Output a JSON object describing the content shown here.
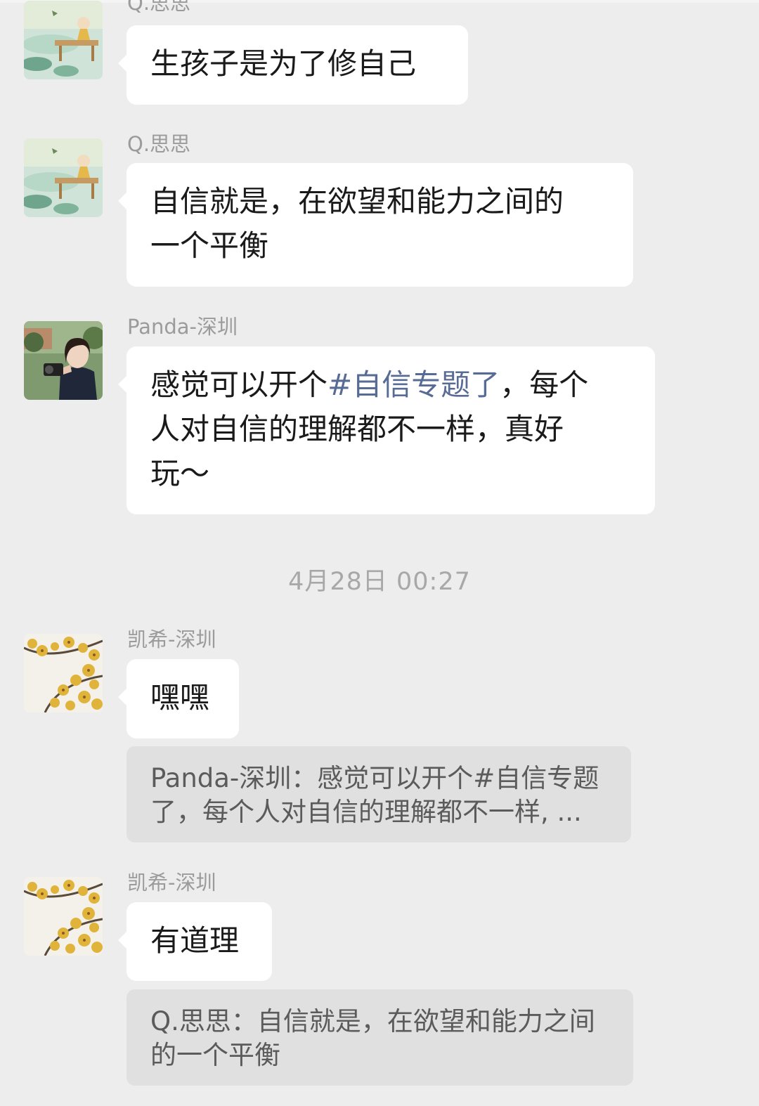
{
  "chat": {
    "messages": [
      {
        "sender": "Q.思思",
        "avatar_icon": "avatar-lotus-pond-illustration-icon",
        "text": "生孩子是为了修自己"
      },
      {
        "sender": "Q.思思",
        "avatar_icon": "avatar-lotus-pond-illustration-icon",
        "lines": [
          "自信就是，在欲望和能力之间的",
          "一个平衡"
        ]
      },
      {
        "sender": "Panda-深圳",
        "avatar_icon": "avatar-photographer-photo-icon",
        "line1_prefix": "感觉可以开个",
        "hashtag": "#自信专题了",
        "line1_suffix": "，每个",
        "line2": "人对自信的理解都不一样，真好",
        "line3": "玩～"
      },
      {
        "sender": "凯希-深圳",
        "avatar_icon": "avatar-yellow-blossoms-icon",
        "text": "嘿嘿",
        "quote_lines": [
          "Panda-深圳：感觉可以开个#自信专题",
          "了，每个人对自信的理解都不一样, ..."
        ]
      },
      {
        "sender": "凯希-深圳",
        "avatar_icon": "avatar-yellow-blossoms-icon",
        "text": "有道理",
        "quote_lines": [
          "Q.思思：自信就是，在欲望和能力之间",
          "的一个平衡"
        ]
      }
    ],
    "timestamp": "4月28日 00:27"
  },
  "colors": {
    "background": "#ededed",
    "bubble": "#ffffff",
    "quote_background": "#e0e0e0",
    "hashtag": "#576b95",
    "sender_name": "#9b9b9b"
  }
}
